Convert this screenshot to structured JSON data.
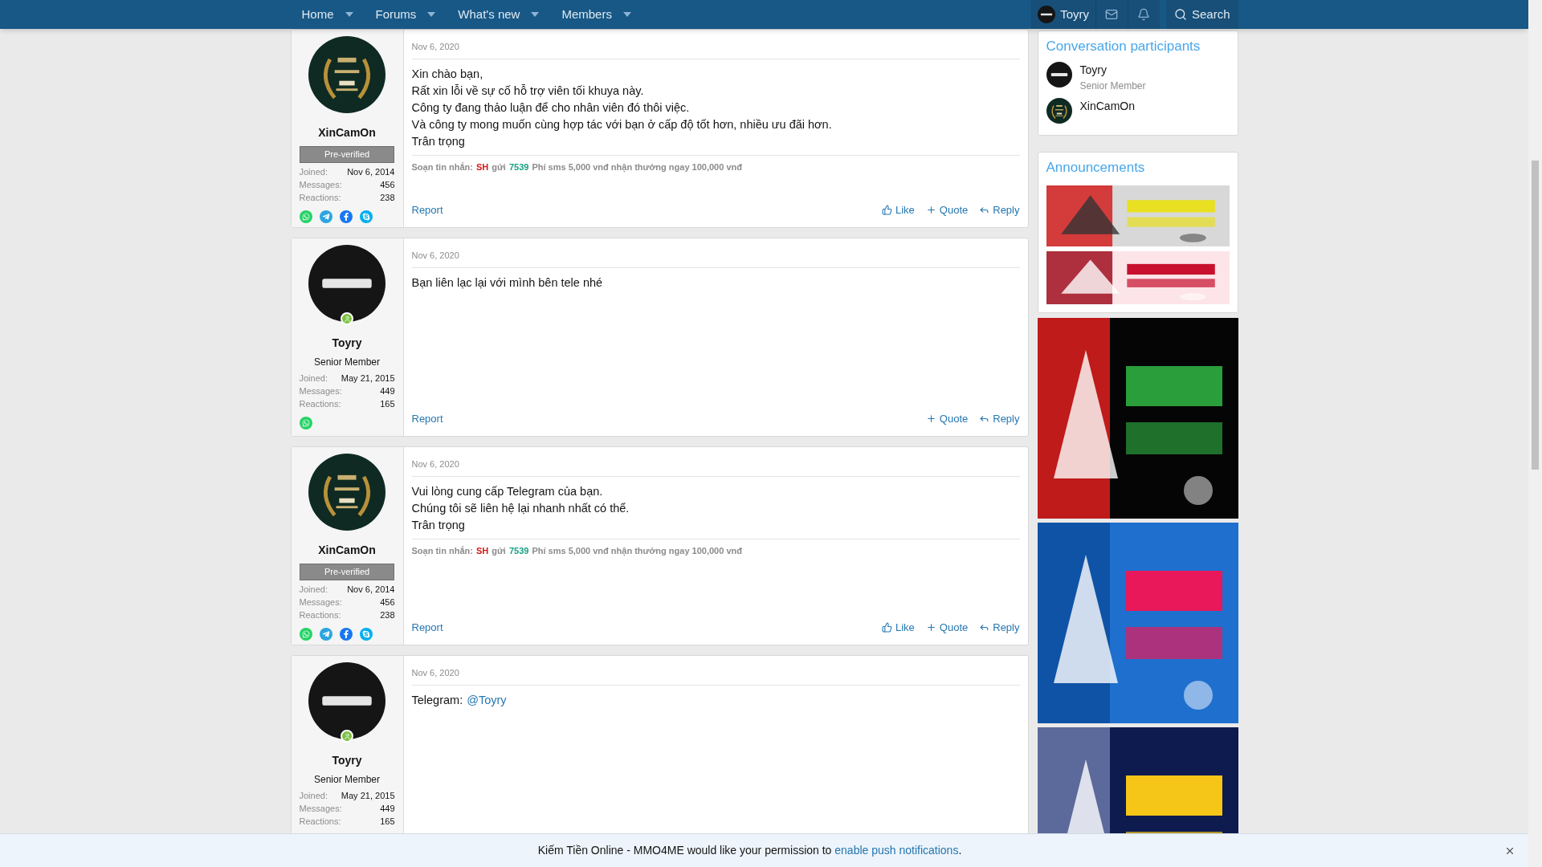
{
  "nav": {
    "items": [
      {
        "label": "Home"
      },
      {
        "label": "Forums"
      },
      {
        "label": "What's new"
      },
      {
        "label": "Members"
      }
    ],
    "user": {
      "name": "Toyry",
      "avatar": {
        "kind": "logo"
      }
    },
    "search": "Search"
  },
  "posts": [
    {
      "author": {
        "name": "XinCamOn",
        "avatar": {
          "kind": "wreath"
        },
        "online": false,
        "badge": "Pre-verified",
        "stats": [
          {
            "label": "Joined:",
            "value": "Nov 6, 2014"
          },
          {
            "label": "Messages:",
            "value": "456"
          },
          {
            "label": "Reactions:",
            "value": "238"
          }
        ],
        "contacts": [
          {
            "kind": "phone"
          },
          {
            "kind": "plane"
          },
          {
            "kind": "facebook"
          },
          {
            "kind": "skype"
          }
        ]
      },
      "date": "Nov 6, 2020",
      "body": [
        [
          {
            "text": "Xin chào bạn,",
            "link": false
          }
        ],
        [
          {
            "text": "Rất xin lỗi về sự cố hỗ trợ viên tối khuya này.",
            "link": false
          }
        ],
        [
          {
            "text": "Công ty đang thảo luận để cho nhân viên đó thôi việc.",
            "link": false
          }
        ],
        [
          {
            "text": "Và công ty mong muốn cùng hợp tác với bạn ở cấp độ tốt hơn, nhiều ưu đãi hơn.",
            "link": false
          }
        ],
        [
          {
            "text": "Trân trọng",
            "link": false
          }
        ]
      ],
      "signature": [
        {
          "text": "Soạn tin nhắn:",
          "color": "#8c8c8c"
        },
        {
          "text": "SH",
          "color": "#d01818"
        },
        {
          "text": "gửi",
          "color": "#8c8c8c"
        },
        {
          "text": "7539",
          "color": "#16a085"
        },
        {
          "text": "Phí sms 5,000 vnđ nhận thưởng ngay 100,000 vnđ",
          "color": "#8c8c8c"
        }
      ],
      "report": "Report",
      "actions": [
        {
          "kind": "like",
          "label": "Like"
        },
        {
          "kind": "quote",
          "label": "Quote"
        },
        {
          "kind": "reply",
          "label": "Reply"
        }
      ]
    },
    {
      "author": {
        "name": "Toyry",
        "avatar": {
          "kind": "logo"
        },
        "online": true,
        "title": "Senior Member",
        "stats": [
          {
            "label": "Joined:",
            "value": "May 21, 2015"
          },
          {
            "label": "Messages:",
            "value": "449"
          },
          {
            "label": "Reactions:",
            "value": "165"
          }
        ],
        "contacts": [
          {
            "kind": "phone"
          }
        ]
      },
      "date": "Nov 6, 2020",
      "body": [
        [
          {
            "text": "Bạn liên lạc lại với mình bên tele nhé",
            "link": false
          }
        ]
      ],
      "report": "Report",
      "actions": [
        {
          "kind": "quote",
          "label": "Quote"
        },
        {
          "kind": "reply",
          "label": "Reply"
        }
      ]
    },
    {
      "author": {
        "name": "XinCamOn",
        "avatar": {
          "kind": "wreath"
        },
        "online": false,
        "badge": "Pre-verified",
        "stats": [
          {
            "label": "Joined:",
            "value": "Nov 6, 2014"
          },
          {
            "label": "Messages:",
            "value": "456"
          },
          {
            "label": "Reactions:",
            "value": "238"
          }
        ],
        "contacts": [
          {
            "kind": "phone"
          },
          {
            "kind": "plane"
          },
          {
            "kind": "facebook"
          },
          {
            "kind": "skype"
          }
        ]
      },
      "date": "Nov 6, 2020",
      "body": [
        [
          {
            "text": "Vui lòng cung cấp Telegram của bạn.",
            "link": false
          }
        ],
        [
          {
            "text": "Chúng tôi sẽ liên hệ lại nhanh nhất có thể.",
            "link": false
          }
        ],
        [
          {
            "text": "Trân trọng",
            "link": false
          }
        ]
      ],
      "signature": [
        {
          "text": "Soạn tin nhắn:",
          "color": "#8c8c8c"
        },
        {
          "text": "SH",
          "color": "#d01818"
        },
        {
          "text": "gửi",
          "color": "#8c8c8c"
        },
        {
          "text": "7539",
          "color": "#16a085"
        },
        {
          "text": "Phí sms 5,000 vnđ nhận thưởng ngay 100,000 vnđ",
          "color": "#8c8c8c"
        }
      ],
      "report": "Report",
      "actions": [
        {
          "kind": "like",
          "label": "Like"
        },
        {
          "kind": "quote",
          "label": "Quote"
        },
        {
          "kind": "reply",
          "label": "Reply"
        }
      ]
    },
    {
      "author": {
        "name": "Toyry",
        "avatar": {
          "kind": "logo"
        },
        "online": true,
        "title": "Senior Member",
        "stats": [
          {
            "label": "Joined:",
            "value": "May 21, 2015"
          },
          {
            "label": "Messages:",
            "value": "449"
          },
          {
            "label": "Reactions:",
            "value": "165"
          }
        ]
      },
      "date": "Nov 6, 2020",
      "body": [
        [
          {
            "text": "Telegram:",
            "link": false
          },
          {
            "text": "@Toyry",
            "link": true
          }
        ]
      ]
    }
  ],
  "sidebar": {
    "participants": {
      "title": "Conversation participants",
      "items": [
        {
          "name": "Toyry",
          "title": "Senior Member",
          "avatar": {
            "kind": "logo"
          }
        },
        {
          "name": "XinCamOn",
          "avatar": {
            "kind": "wreath"
          }
        }
      ]
    },
    "announcements": {
      "title": "Announcements"
    }
  },
  "notice": {
    "text": "Kiếm Tiền Online - MMO4ME would like your permission to",
    "link": "enable push notifications",
    "end": "."
  }
}
